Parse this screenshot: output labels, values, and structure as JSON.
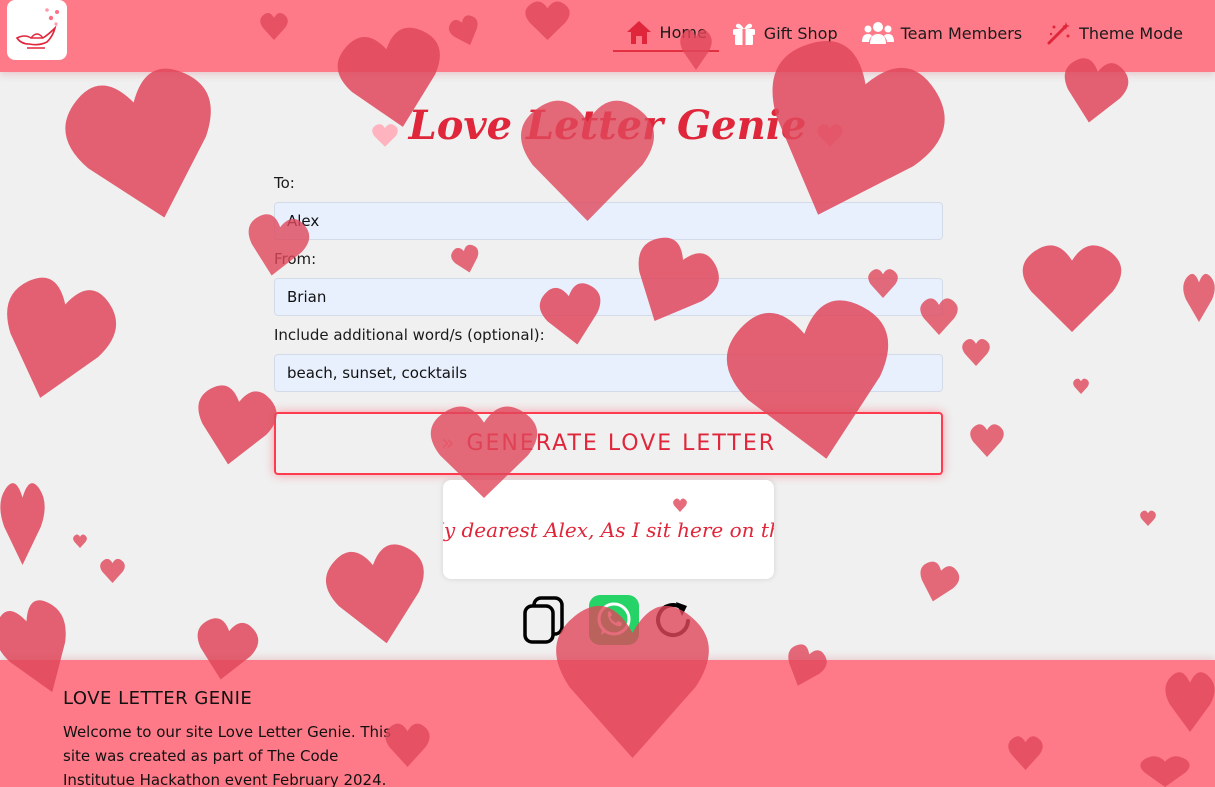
{
  "nav": {
    "logo_icon": "genie-lamp-hearts-icon",
    "items": [
      {
        "label": "Home",
        "icon": "home-icon",
        "active": true
      },
      {
        "label": "Gift Shop",
        "icon": "gift-icon"
      },
      {
        "label": "Team Members",
        "icon": "users-icon"
      },
      {
        "label": "Theme Mode",
        "icon": "wand-icon"
      }
    ]
  },
  "main": {
    "title": "Love Letter Genie",
    "form": {
      "to_label": "To:",
      "to_value": "Alex",
      "from_label": "From:",
      "from_value": "Brian",
      "words_label": "Include additional word/s (optional):",
      "words_value": "beach, sunset, cocktails",
      "generate_label": "GENERATE LOVE LETTER"
    },
    "letter_preview": "My dearest Alex, As I sit here on the",
    "actions": [
      {
        "name": "copy",
        "icon": "copy-icon"
      },
      {
        "name": "whatsapp",
        "icon": "whatsapp-icon"
      },
      {
        "name": "refresh",
        "icon": "refresh-icon"
      }
    ]
  },
  "footer": {
    "title": "LOVE LETTER GENIE",
    "text": "Welcome to our site Love Letter Genie. This site was created as part of The Code Institutue Hackathon event February 2024."
  },
  "colors": {
    "accent": "#e0263a",
    "navbar": "#ff7a88",
    "heart": "#e0485c",
    "field_bg": "#e8f0fe"
  }
}
